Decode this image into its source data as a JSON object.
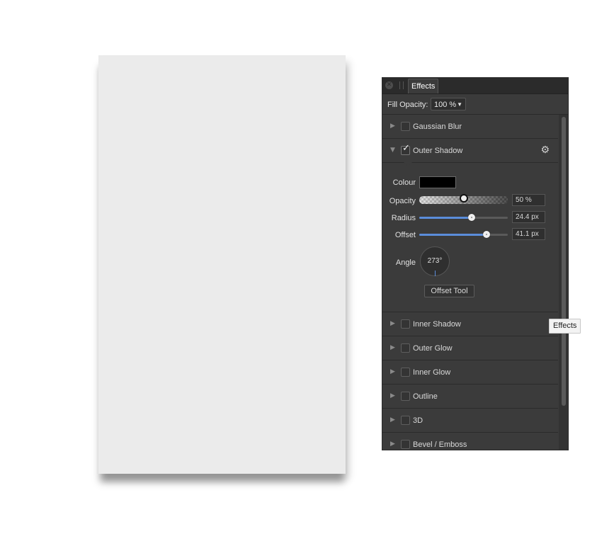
{
  "panel": {
    "tab_label": "Effects",
    "fill_opacity_label": "Fill Opacity:",
    "fill_opacity_value": "100 %",
    "effects": [
      {
        "label": "Gaussian Blur",
        "checked": false
      },
      {
        "label": "Outer Shadow",
        "checked": true,
        "expanded": true
      },
      {
        "label": "Inner Shadow",
        "checked": false
      },
      {
        "label": "Outer Glow",
        "checked": false
      },
      {
        "label": "Inner Glow",
        "checked": false
      },
      {
        "label": "Outline",
        "checked": false
      },
      {
        "label": "3D",
        "checked": false
      },
      {
        "label": "Bevel / Emboss",
        "checked": false
      }
    ],
    "outer_shadow": {
      "colour_label": "Colour",
      "colour_value": "#000000",
      "opacity_label": "Opacity",
      "opacity_value": "50 %",
      "opacity_fraction": 0.5,
      "radius_label": "Radius",
      "radius_value": "24.4 px",
      "radius_fraction": 0.59,
      "offset_label": "Offset",
      "offset_value": "41.1 px",
      "offset_fraction": 0.76,
      "angle_label": "Angle",
      "angle_value": "273°",
      "offset_tool_label": "Offset Tool"
    }
  },
  "tooltip": {
    "text": "Effects"
  },
  "colors": {
    "accent": "#5b8ddb",
    "panel_bg": "#3b3b3b",
    "canvas_doc": "#ebebeb"
  }
}
